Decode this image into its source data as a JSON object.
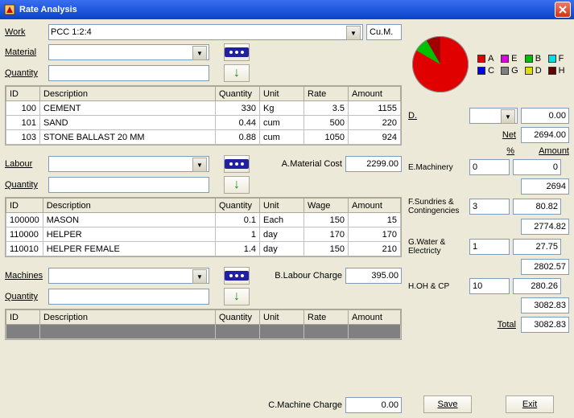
{
  "window": {
    "title": "Rate Analysis"
  },
  "work": {
    "label": "Work",
    "value": "PCC 1:2:4",
    "unit": "Cu.M."
  },
  "material": {
    "label": "Material",
    "qty_label": "Quantity",
    "select_btn": "...",
    "add_btn": "↓"
  },
  "material_cols": {
    "id": "ID",
    "desc": "Description",
    "qty": "Quantity",
    "unit": "Unit",
    "rate": "Rate",
    "amount": "Amount"
  },
  "material_rows": [
    {
      "id": "100",
      "desc": "CEMENT",
      "qty": "330",
      "unit": "Kg",
      "rate": "3.5",
      "amount": "1155"
    },
    {
      "id": "101",
      "desc": "SAND",
      "qty": "0.44",
      "unit": "cum",
      "rate": "500",
      "amount": "220"
    },
    {
      "id": "103",
      "desc": "STONE BALLAST 20 MM",
      "qty": "0.88",
      "unit": "cum",
      "rate": "1050",
      "amount": "924"
    }
  ],
  "material_cost": {
    "label": "A.Material Cost",
    "value": "2299.00"
  },
  "labour": {
    "label": "Labour",
    "qty_label": "Quantity"
  },
  "labour_cols": {
    "id": "ID",
    "desc": "Description",
    "qty": "Quantity",
    "unit": "Unit",
    "wage": "Wage",
    "amount": "Amount"
  },
  "labour_rows": [
    {
      "id": "100000",
      "desc": "MASON",
      "qty": "0.1",
      "unit": "Each",
      "wage": "150",
      "amount": "15"
    },
    {
      "id": "110000",
      "desc": "HELPER",
      "qty": "1",
      "unit": "day",
      "wage": "170",
      "amount": "170"
    },
    {
      "id": "110010",
      "desc": "HELPER FEMALE",
      "qty": "1.4",
      "unit": "day",
      "wage": "150",
      "amount": "210"
    }
  ],
  "labour_charge": {
    "label": "B.Labour Charge",
    "value": "395.00"
  },
  "machines": {
    "label": "Machines",
    "qty_label": "Quantity"
  },
  "machine_cols": {
    "id": "ID",
    "desc": "Description",
    "qty": "Quantity",
    "unit": "Unit",
    "rate": "Rate",
    "amount": "Amount"
  },
  "machine_charge": {
    "label": "C.Machine Charge",
    "value": "0.00"
  },
  "legend": {
    "A": "A",
    "B": "B",
    "C": "C",
    "D": "D",
    "E": "E",
    "F": "F",
    "G": "G",
    "H": "H"
  },
  "colors": {
    "A": "#e00000",
    "B": "#00c000",
    "C": "#0000e0",
    "D": "#e0e000",
    "E": "#e000e0",
    "F": "#00e0e0",
    "G": "#808080",
    "H": "#600000"
  },
  "calc": {
    "d_label": "D.",
    "d_value": "0.00",
    "net_label": "Net",
    "net_value": "2694.00",
    "pct_label": "%",
    "amt_label": "Amount",
    "e_label": "E.Machinery",
    "e_pct": "0",
    "e_amt": "0",
    "sub1": "2694",
    "f_label": "F.Sundries & Contingencies",
    "f_pct": "3",
    "f_amt": "80.82",
    "sub2": "2774.82",
    "g_label": "G.Water & Electricty",
    "g_pct": "1",
    "g_amt": "27.75",
    "sub3": "2802.57",
    "h_label": "H.OH & CP",
    "h_pct": "10",
    "h_amt": "280.26",
    "sub4": "3082.83",
    "total_label": "Total",
    "total": "3082.83"
  },
  "buttons": {
    "save": "Save",
    "exit": "Exit"
  },
  "chart_data": {
    "type": "pie",
    "title": "",
    "series": [
      {
        "name": "A",
        "value": 83,
        "color": "#e00000"
      },
      {
        "name": "B",
        "value": 8,
        "color": "#00c000"
      },
      {
        "name": "H",
        "value": 9,
        "color": "#600000"
      }
    ]
  }
}
